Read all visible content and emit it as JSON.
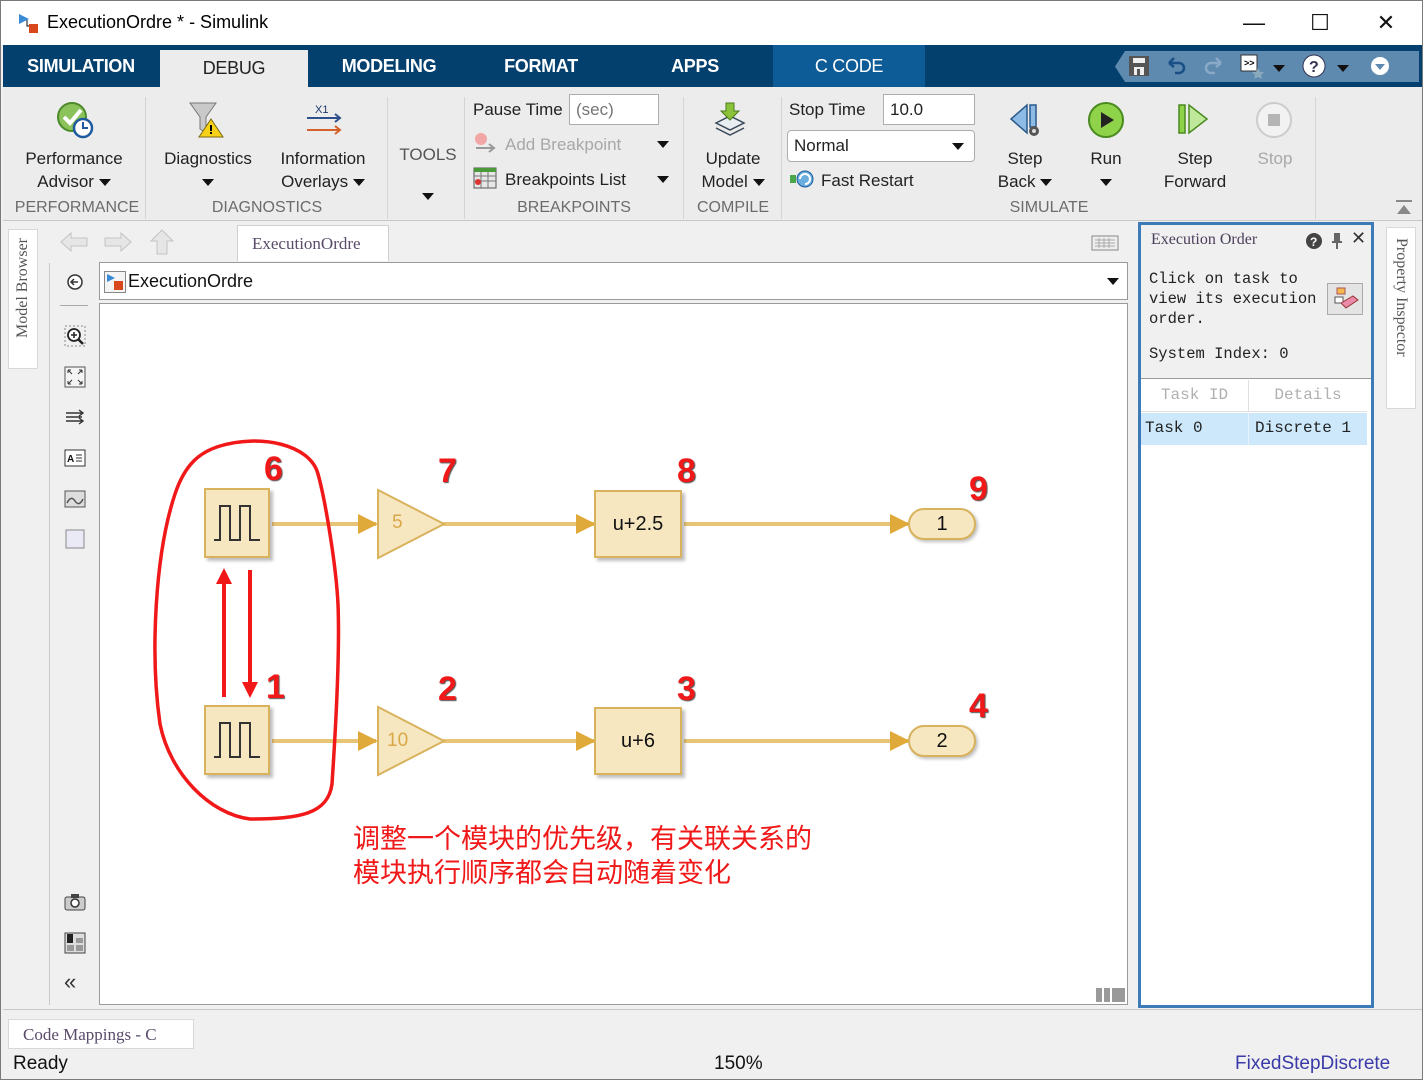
{
  "window": {
    "title": "ExecutionOrdre * - Simulink",
    "controls": {
      "minimize": "—",
      "maximize": "☐",
      "close": "✕"
    }
  },
  "tabs": [
    {
      "label": "SIMULATION",
      "active": false
    },
    {
      "label": "DEBUG",
      "active": true
    },
    {
      "label": "MODELING",
      "active": false
    },
    {
      "label": "FORMAT",
      "active": false
    },
    {
      "label": "APPS",
      "active": false
    },
    {
      "label": "C CODE",
      "active": false
    }
  ],
  "quick_access": [
    "save-icon",
    "undo-icon",
    "redo-icon",
    "command-icon",
    "help-icon",
    "options-icon"
  ],
  "ribbon": {
    "performance": {
      "group_label": "PERFORMANCE",
      "advisor_line1": "Performance",
      "advisor_line2": "Advisor"
    },
    "diagnostics": {
      "group_label": "DIAGNOSTICS",
      "diagnostics_label": "Diagnostics",
      "overlays_line1": "Information",
      "overlays_line2": "Overlays",
      "overlay_icon_text": "X1"
    },
    "tools": {
      "label": "TOOLS"
    },
    "breakpoints": {
      "group_label": "BREAKPOINTS",
      "pause_time_label": "Pause Time",
      "pause_time_placeholder": "(sec)",
      "add_breakpoint": "Add Breakpoint",
      "breakpoints_list": "Breakpoints List"
    },
    "compile": {
      "group_label": "COMPILE",
      "update_line1": "Update",
      "update_line2": "Model"
    },
    "simulate": {
      "group_label": "SIMULATE",
      "stop_time_label": "Stop Time",
      "stop_time_value": "10.0",
      "mode_value": "Normal",
      "fast_restart": "Fast Restart",
      "step_back_line1": "Step",
      "step_back_line2": "Back",
      "run": "Run",
      "step_forward_line1": "Step",
      "step_forward_line2": "Forward",
      "stop": "Stop"
    }
  },
  "side_tabs": {
    "model_browser": "Model Browser",
    "property_inspector": "Property Inspector"
  },
  "editor": {
    "breadcrumb_tab": "ExecutionOrdre",
    "address": "ExecutionOrdre",
    "zoom": "150%",
    "blocks": {
      "gain_top": "5",
      "fcn_top": "u+2.5",
      "out_top": "1",
      "gain_bottom": "10",
      "fcn_bottom": "u+6",
      "out_bottom": "2"
    },
    "execution_order_labels": {
      "pulse_top": "6",
      "gain_top": "7",
      "fcn_top": "8",
      "out_top": "9",
      "pulse_bottom": "1",
      "gain_bottom": "2",
      "fcn_bottom": "3",
      "out_bottom": "4"
    },
    "annotation_line1": "调整一个模块的优先级，有关联关系的",
    "annotation_line2": "模块执行顺序都会自动随着变化"
  },
  "execution_order_panel": {
    "title": "Execution Order",
    "hint": "Click on task to view its execution order.",
    "hint_line1": "Click on task to",
    "hint_line2": "view its execution",
    "hint_line3": "order.",
    "system_index": "System Index: 0",
    "columns": [
      "Task ID",
      "Details"
    ],
    "rows": [
      {
        "task_id": "Task 0",
        "details": "Discrete 1"
      }
    ]
  },
  "bottom": {
    "code_mappings_tab": "Code Mappings - C",
    "status": "Ready",
    "zoom": "150%",
    "solver": "FixedStepDiscrete"
  },
  "colors": {
    "tabstrip": "#03406e",
    "ccode_tab": "#0d5c97",
    "block_fill": "#f7e7c1",
    "block_border": "#d8b25c",
    "signal": "#e6c06a",
    "annotation_red": "#f01818",
    "panel_border": "#3d7ab8",
    "table_selected": "#cde8fb"
  }
}
